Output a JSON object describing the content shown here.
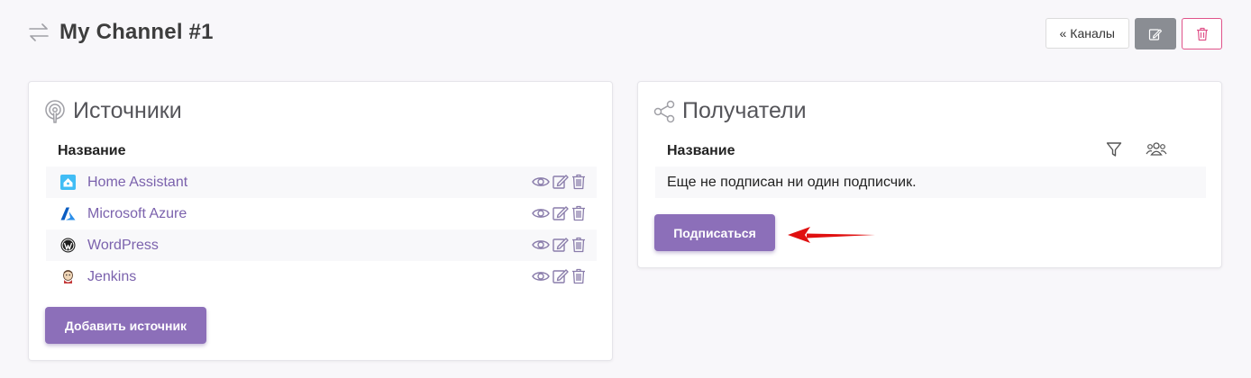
{
  "header": {
    "title": "My Channel #1",
    "channels_button": "Каналы",
    "channels_chevron": "«"
  },
  "sources": {
    "title": "Источники",
    "column_name": "Название",
    "items": [
      {
        "label": "Home Assistant",
        "icon": "home-assistant-icon"
      },
      {
        "label": "Microsoft Azure",
        "icon": "azure-icon"
      },
      {
        "label": "WordPress",
        "icon": "wordpress-icon"
      },
      {
        "label": "Jenkins",
        "icon": "jenkins-icon"
      }
    ],
    "add_button": "Добавить источник"
  },
  "recipients": {
    "title": "Получатели",
    "column_name": "Название",
    "empty_text": "Еще не подписан ни один подписчик.",
    "subscribe_button": "Подписаться"
  },
  "colors": {
    "accent": "#8c6fb9",
    "link": "#7b62ad",
    "danger": "#e0538a",
    "annotation_arrow": "#e01010"
  }
}
